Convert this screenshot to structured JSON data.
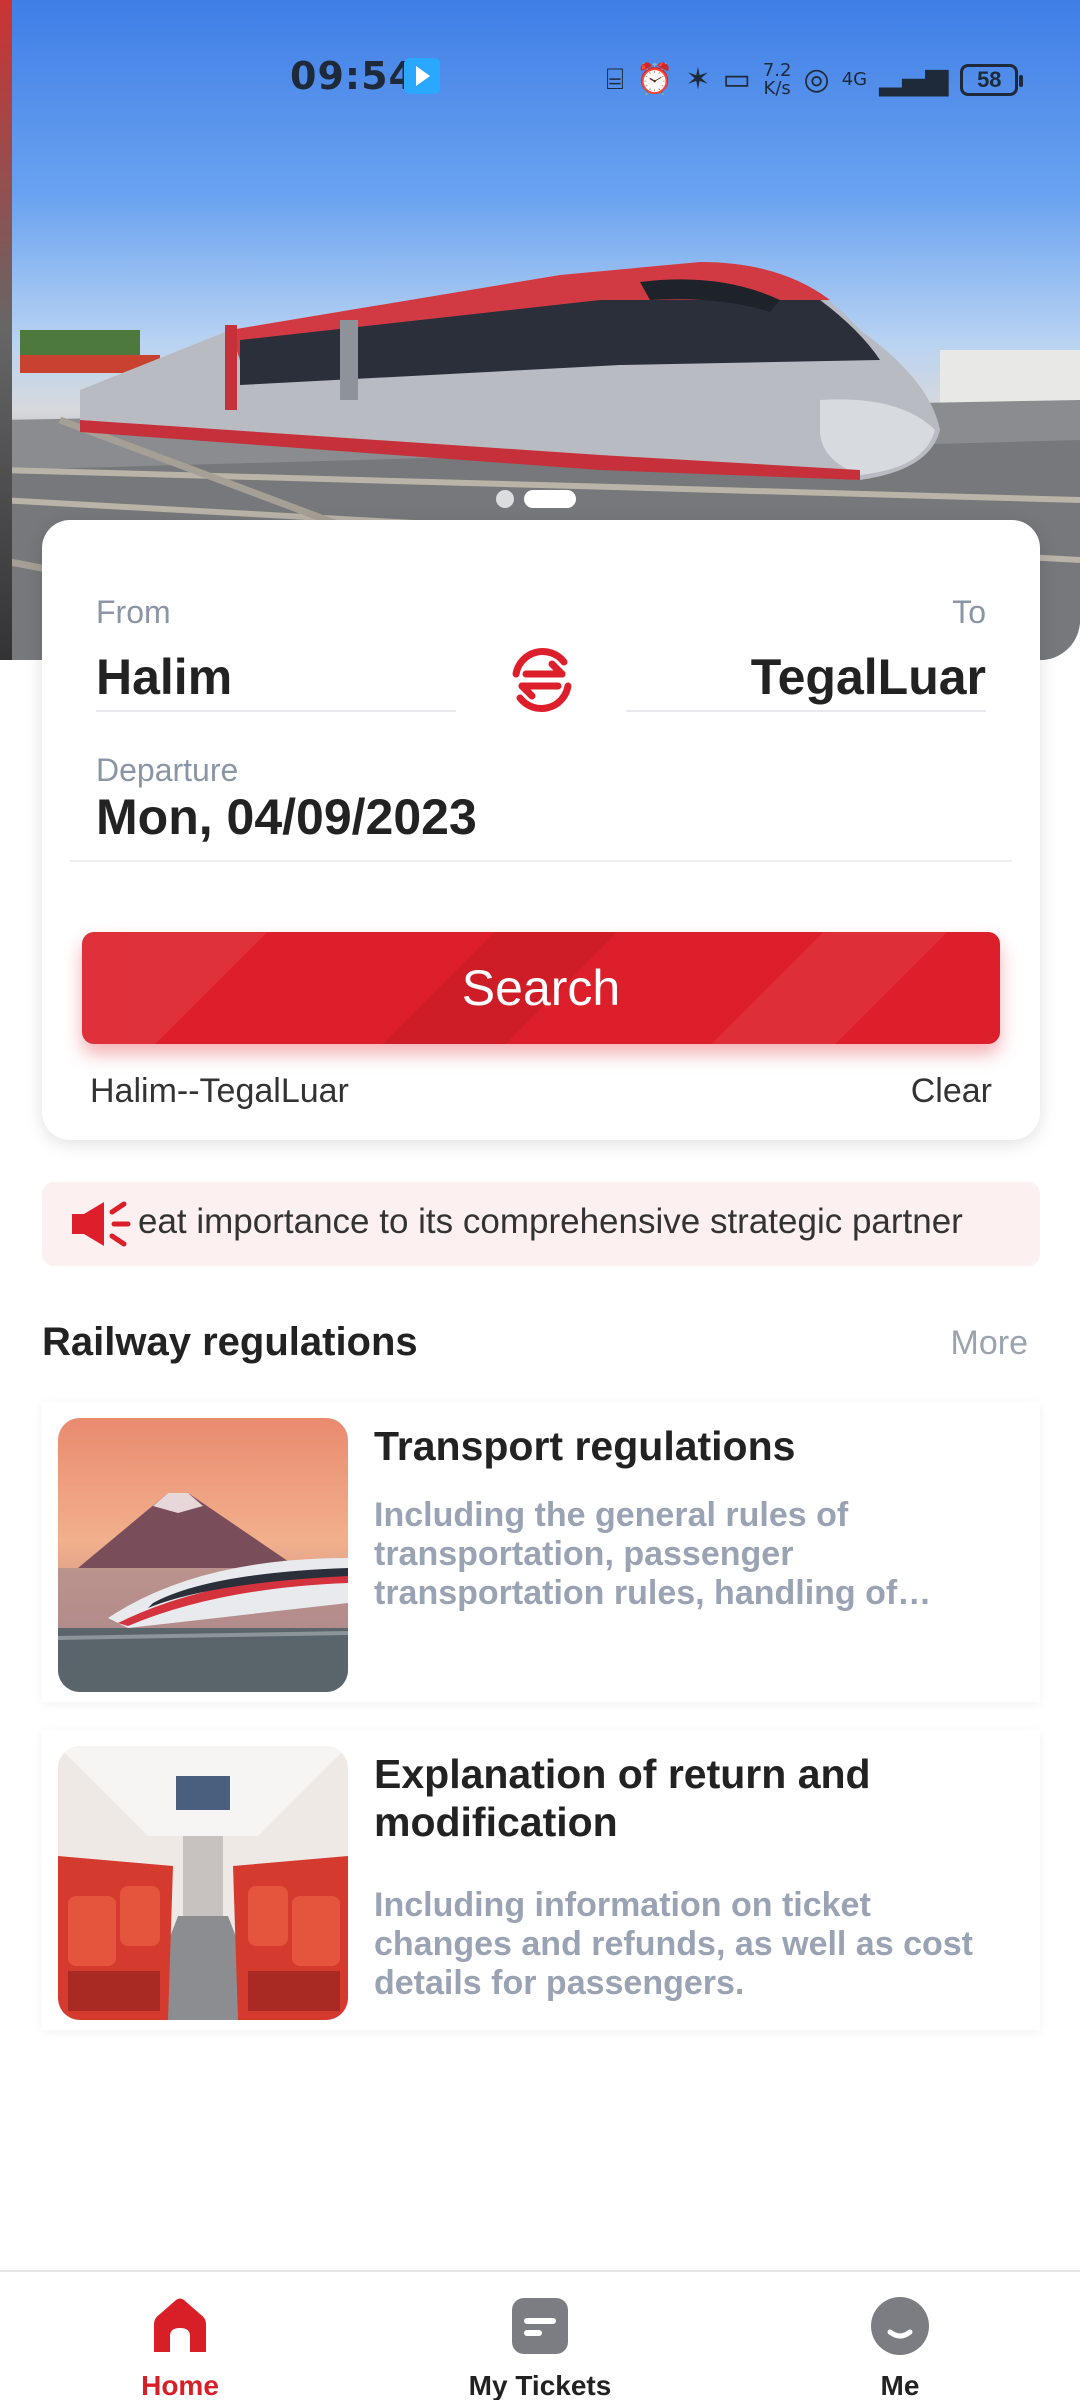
{
  "status_bar": {
    "time": "09:54",
    "network_speed_value": "7.2",
    "network_speed_unit": "K/s",
    "network_type": "4G",
    "battery": "58"
  },
  "booking": {
    "from_label": "From",
    "from_station": "Halim",
    "to_label": "To",
    "to_station": "TegalLuar",
    "departure_label": "Departure",
    "departure_date": "Mon, 04/09/2023",
    "search_label": "Search",
    "recent_route": "Halim--TegalLuar",
    "clear_label": "Clear"
  },
  "announcement": {
    "text": "eat importance to its comprehensive strategic partner"
  },
  "regulations": {
    "title": "Railway regulations",
    "more_label": "More",
    "items": [
      {
        "title": "Transport regulations",
        "description": "Including the general rules of transportation, passenger transportation rules, handling of…"
      },
      {
        "title": "Explanation of return and modification",
        "description": "Including information on ticket changes and refunds, as well as cost details for passengers."
      }
    ]
  },
  "nav": {
    "home_label": "Home",
    "tickets_label": "My Tickets",
    "me_label": "Me"
  },
  "colors": {
    "accent_red": "#dc1f2a",
    "nav_active": "#d81e27",
    "muted_text": "#8a95a5"
  },
  "icons": {
    "swap": "swap-arrows-icon",
    "announcement": "megaphone-icon",
    "home": "home-icon",
    "tickets": "ticket-icon",
    "me": "smiley-face-icon"
  },
  "carousel": {
    "slide_count": 2,
    "active_slide": 2
  }
}
